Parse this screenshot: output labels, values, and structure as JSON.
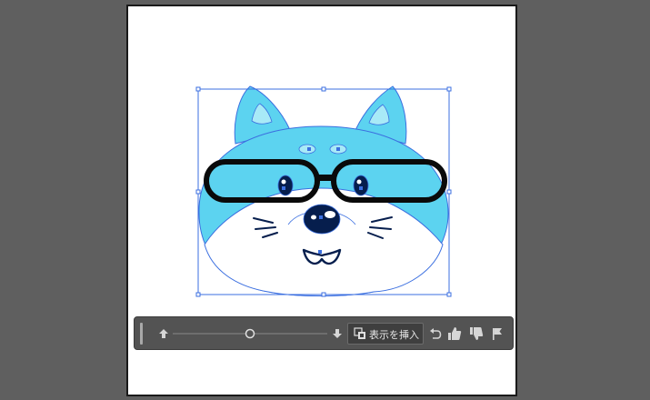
{
  "context_bar": {
    "insert_view_label": "表示を挿入",
    "slider_level": 0.5,
    "icons": {
      "grip": "grip-handle-icon",
      "step_up": "arrow-up-icon",
      "step_down": "arrow-down-icon",
      "insert": "insert-view-icon",
      "undo": "undo-icon",
      "like": "thumbs-up-icon",
      "dislike": "thumbs-down-icon",
      "flag": "flag-icon"
    }
  },
  "colors": {
    "workspace": "#5f5f5f",
    "artboard": "#ffffff",
    "fur": "#5cd3f0",
    "ear_inner": "#a8eaf7",
    "glasses": "#0a0a0a",
    "nose": "#061e4d",
    "selection": "#3b6fe0",
    "bar": "#535353"
  }
}
